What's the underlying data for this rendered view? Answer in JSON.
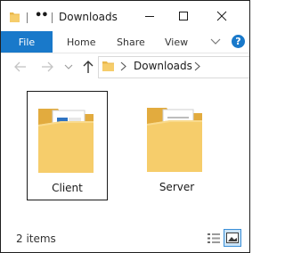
{
  "window": {
    "title": "Downloads",
    "title_icon": "folder-icon"
  },
  "quick_access": {
    "overflow_label": "••"
  },
  "ribbon": {
    "tabs": [
      {
        "label": "File",
        "active": true
      },
      {
        "label": "Home"
      },
      {
        "label": "Share"
      },
      {
        "label": "View"
      }
    ],
    "help_label": "?"
  },
  "address_bar": {
    "segments": [
      "Downloads"
    ]
  },
  "files": [
    {
      "name": "Client",
      "selected": true,
      "icon": "folder-with-documents-icon"
    },
    {
      "name": "Server",
      "selected": false,
      "icon": "folder-with-documents-icon"
    }
  ],
  "status_bar": {
    "item_count": "2 items",
    "active_view": "large-icons"
  },
  "colors": {
    "accent": "#1979ca",
    "folder": "#f5c463",
    "selection_border": "#1a1a1a"
  }
}
